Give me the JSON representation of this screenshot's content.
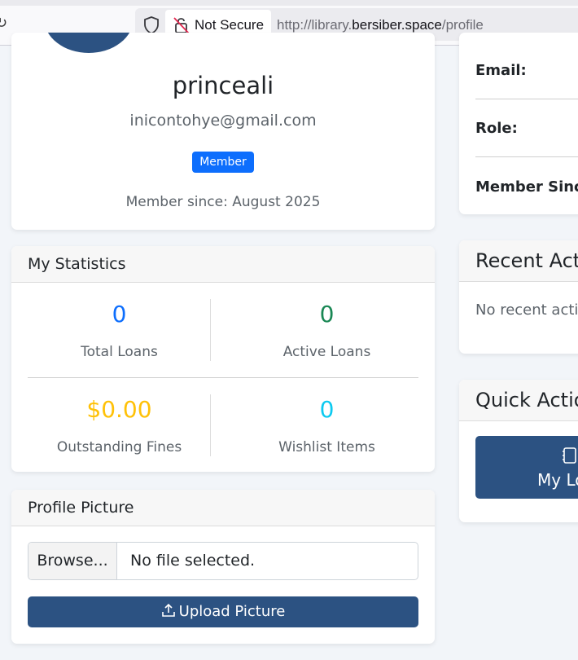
{
  "browser": {
    "security_label": "Not Secure",
    "url_prefix": "http://library.",
    "url_host": "bersiber.space",
    "url_path": "/profile"
  },
  "profile": {
    "username": "princeali",
    "email": "inicontohye@gmail.com",
    "badge": "Member",
    "member_since": "Member since: August 2025"
  },
  "stats": {
    "title": "My Statistics",
    "items": [
      {
        "value": "0",
        "label": "Total Loans",
        "color": "#0d6efd"
      },
      {
        "value": "0",
        "label": "Active Loans",
        "color": "#198754"
      },
      {
        "value": "$0.00",
        "label": "Outstanding Fines",
        "color": "#ffc107"
      },
      {
        "value": "0",
        "label": "Wishlist Items",
        "color": "#0dcaf0"
      }
    ]
  },
  "profile_picture": {
    "title": "Profile Picture",
    "browse_label": "Browse...",
    "file_status": "No file selected.",
    "upload_label": "Upload Picture"
  },
  "account_info": {
    "email_label": "Email:",
    "role_label": "Role:",
    "member_since_label": "Member Since"
  },
  "recent_activity": {
    "title": "Recent Activ",
    "empty": "No recent activ"
  },
  "quick_actions": {
    "title": "Quick Actio",
    "my_loans_label": "My Lo"
  },
  "colors": {
    "primary_dark": "#2c5282",
    "badge_blue": "#0d6efd"
  }
}
